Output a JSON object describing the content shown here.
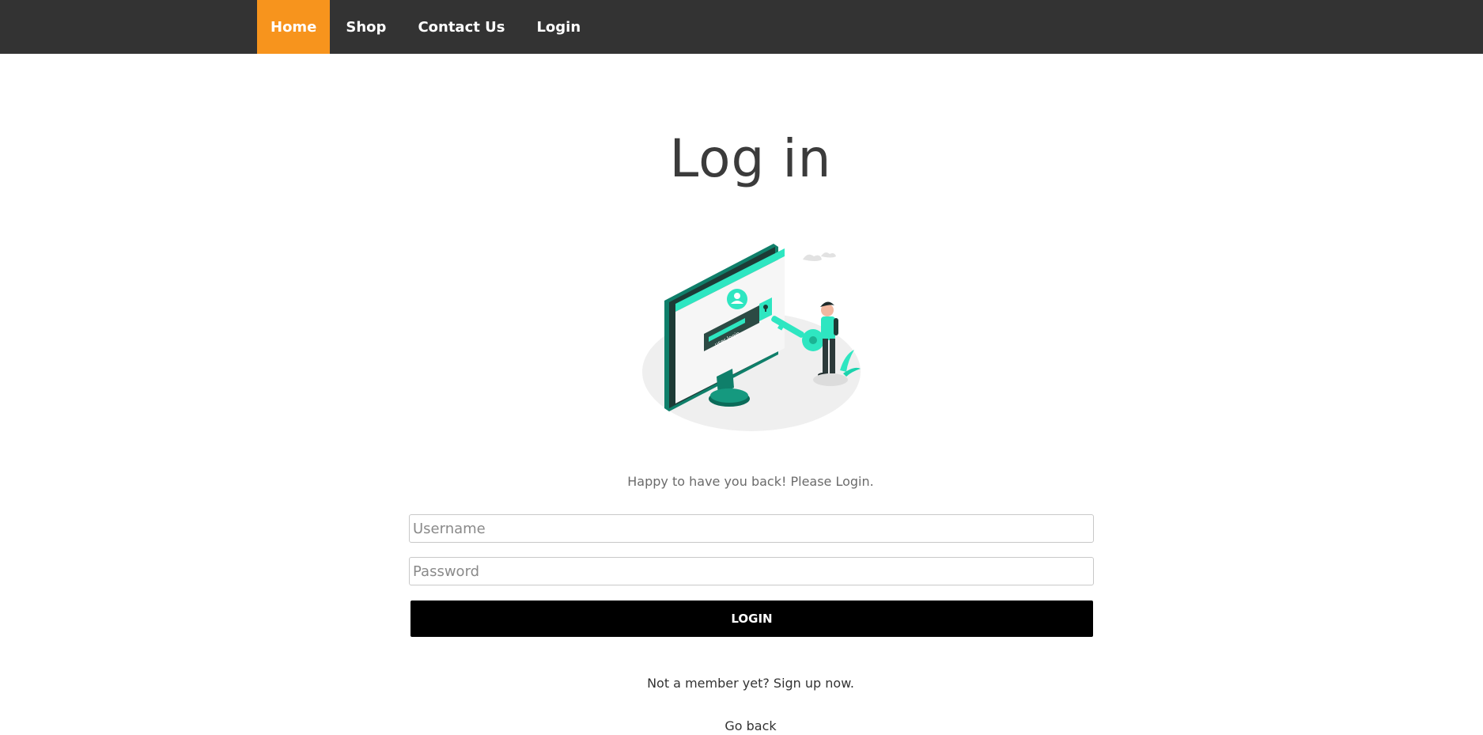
{
  "nav": {
    "items": [
      {
        "label": "Home",
        "active": true
      },
      {
        "label": "Shop",
        "active": false
      },
      {
        "label": "Contact Us",
        "active": false
      },
      {
        "label": "Login",
        "active": false
      }
    ]
  },
  "main": {
    "title": "Log in",
    "illustration_icon": "login-key-illustration",
    "illustration_screen_text": "user login",
    "subtitle": "Happy to have you back! Please Login.",
    "username_placeholder": "Username",
    "password_placeholder": "Password",
    "login_button": "LOGIN",
    "signup_text": "Not a member yet? Sign up now.",
    "go_back": "Go back"
  },
  "colors": {
    "navbar": "#333333",
    "active_nav": "#f7941d",
    "accent_teal": "#2ee6c1",
    "dark_teal": "#0f7f6a",
    "button": "#000000"
  }
}
